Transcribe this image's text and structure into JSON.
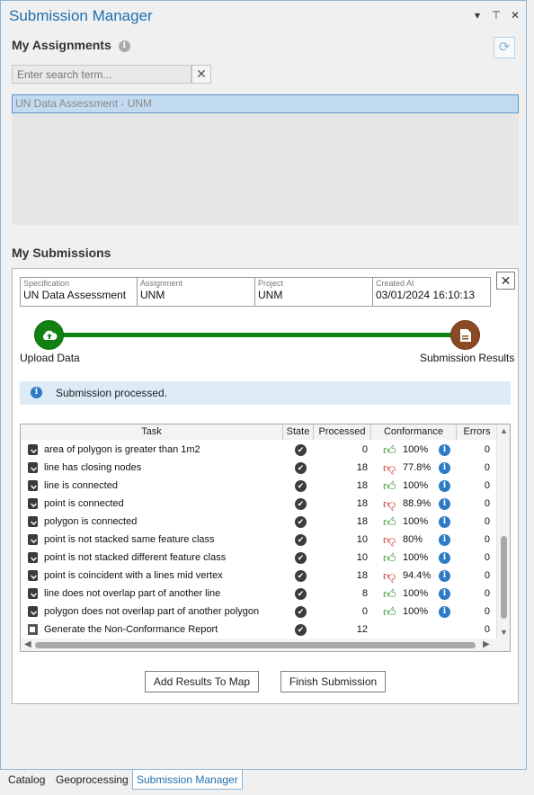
{
  "window": {
    "title": "Submission Manager",
    "buttons": [
      "▾",
      "⊤",
      "✕"
    ]
  },
  "assignments": {
    "heading": "My Assignments",
    "search_placeholder": "Enter search term...",
    "items": [
      "UN Data Assessment - UNM"
    ]
  },
  "submissions": {
    "heading": "My Submissions",
    "meta": [
      {
        "label": "Specification",
        "value": "UN Data Assessment"
      },
      {
        "label": "Assignment",
        "value": "UNM"
      },
      {
        "label": "Project",
        "value": "UNM"
      },
      {
        "label": "Created At",
        "value": "03/01/2024 16:10:13"
      }
    ],
    "steps": {
      "upload": "Upload Data",
      "results": "Submission Results"
    },
    "banner": "Submission processed.",
    "table": {
      "columns": [
        "Task",
        "State",
        "Processed",
        "Conformance",
        "Errors"
      ],
      "rows": [
        {
          "task": "area of polygon is greater than 1m2",
          "processed": "0",
          "conformance": "100%",
          "thumb": "up",
          "errors": "0"
        },
        {
          "task": "line has closing nodes",
          "processed": "18",
          "conformance": "77.8%",
          "thumb": "down",
          "errors": "0"
        },
        {
          "task": "line is connected",
          "processed": "18",
          "conformance": "100%",
          "thumb": "up",
          "errors": "0"
        },
        {
          "task": "point is connected",
          "processed": "18",
          "conformance": "88.9%",
          "thumb": "down",
          "errors": "0"
        },
        {
          "task": "polygon is connected",
          "processed": "18",
          "conformance": "100%",
          "thumb": "up",
          "errors": "0"
        },
        {
          "task": "point is not stacked same feature class",
          "processed": "10",
          "conformance": "80%",
          "thumb": "down",
          "errors": "0"
        },
        {
          "task": "point is not stacked different feature class",
          "processed": "10",
          "conformance": "100%",
          "thumb": "up",
          "errors": "0"
        },
        {
          "task": "point is coincident with a lines mid vertex",
          "processed": "18",
          "conformance": "94.4%",
          "thumb": "down",
          "errors": "0"
        },
        {
          "task": "line does not overlap part of another line",
          "processed": "8",
          "conformance": "100%",
          "thumb": "up",
          "errors": "0"
        },
        {
          "task": "polygon does not overlap part of another polygon",
          "processed": "0",
          "conformance": "100%",
          "thumb": "up",
          "errors": "0"
        },
        {
          "task": "Generate the Non-Conformance Report",
          "processed": "12",
          "conformance": "",
          "thumb": "",
          "errors": "0"
        }
      ]
    },
    "buttons": {
      "add": "Add Results To Map",
      "finish": "Finish Submission"
    }
  },
  "bottom_tabs": [
    "Catalog",
    "Geoprocessing",
    "Submission Manager"
  ],
  "active_tab": "Submission Manager",
  "colors": {
    "accent": "#1f6fae",
    "success": "#118212",
    "results": "#8a4a23",
    "fail": "#cc1c1c"
  }
}
